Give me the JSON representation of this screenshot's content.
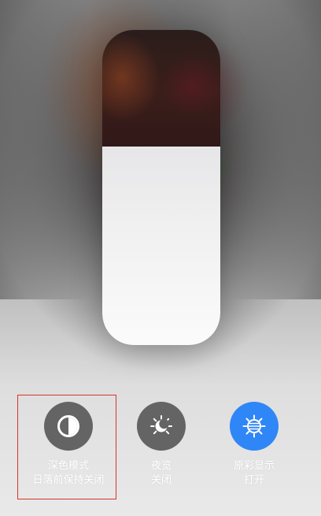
{
  "brightness": {
    "level": 0.63
  },
  "toggles": {
    "dark_mode": {
      "title": "深色模式",
      "subtitle": "日落前保持关闭",
      "active": false,
      "icon": "half-circle-icon"
    },
    "night_shift": {
      "title": "夜览",
      "subtitle": "关闭",
      "active": false,
      "icon": "sun-moon-icon"
    },
    "true_tone": {
      "title": "原彩显示",
      "subtitle": "打开",
      "active": true,
      "icon": "true-tone-sun-icon"
    }
  },
  "colors": {
    "inactive_circle": "#646464",
    "active_circle": "#2f86f6",
    "label": "#ffffff",
    "highlight": "#d9332e"
  }
}
